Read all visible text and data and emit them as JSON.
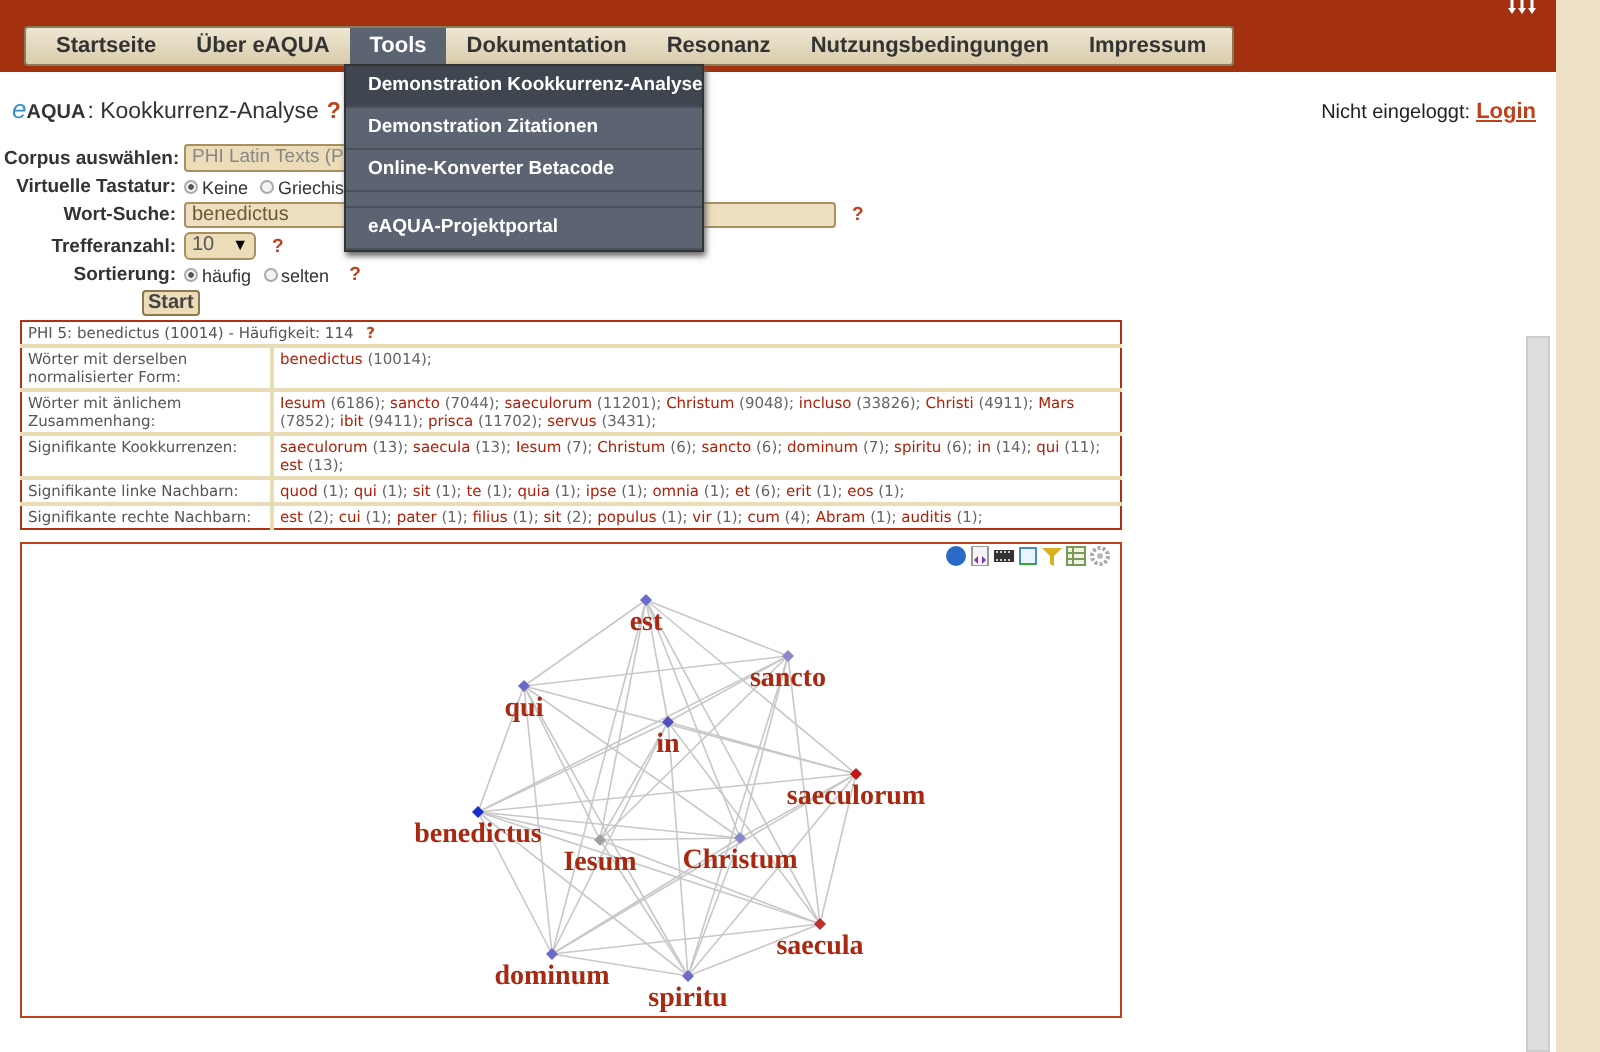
{
  "menu": [
    {
      "label": "Startseite",
      "selected": false
    },
    {
      "label": "Über eAQUA",
      "selected": false
    },
    {
      "label": "Tools",
      "selected": true
    },
    {
      "label": "Dokumentation",
      "selected": false
    },
    {
      "label": "Resonanz",
      "selected": false
    },
    {
      "label": "Nutzungsbedingungen",
      "selected": false
    },
    {
      "label": "Impressum",
      "selected": false
    }
  ],
  "dropdown": [
    {
      "kind": "item",
      "label": "Demonstration Kookkurrenz-Analyse",
      "highlighted": true
    },
    {
      "kind": "item",
      "label": "Demonstration Zitationen",
      "highlighted": false
    },
    {
      "kind": "item",
      "label": "Online-Konverter Betacode",
      "highlighted": false
    },
    {
      "kind": "separator"
    },
    {
      "kind": "item",
      "label": "eAQUA-Projektportal",
      "highlighted": false
    }
  ],
  "header": {
    "logo_prefix": "e",
    "logo": "AQUA",
    "title": ": Kookkurrenz-Analyse",
    "help": "?",
    "login_status": "Nicht eingeloggt:",
    "login_link": "Login"
  },
  "form": {
    "corpus": {
      "label": "Corpus auswählen:",
      "value": "PHI Latin Texts (P"
    },
    "keyboard": {
      "label": "Virtuelle Tastatur:",
      "options": [
        {
          "label": "Keine",
          "selected": true
        },
        {
          "label": "Griechis",
          "selected": false
        }
      ]
    },
    "word": {
      "label": "Wort-Suche:",
      "value": "benedictus",
      "help": "?"
    },
    "hits": {
      "label": "Trefferanzahl:",
      "value": "10",
      "arrow": "▼",
      "help": "?"
    },
    "sort": {
      "label": "Sortierung:",
      "options": [
        {
          "label": "häufig",
          "selected": true
        },
        {
          "label": "selten",
          "selected": false
        }
      ],
      "help": "?"
    },
    "start": "Start"
  },
  "results": {
    "title": "PHI 5: benedictus (10014) - Häufigkeit: 114",
    "help": "?",
    "rows": [
      {
        "label": "Wörter mit derselben normalisierter Form:",
        "entries": [
          {
            "word": "benedictus",
            "count": "(10014);"
          }
        ]
      },
      {
        "label": "Wörter mit änlichem Zusammenhang:",
        "entries": [
          {
            "word": "Iesum",
            "count": "(6186);"
          },
          {
            "word": "sancto",
            "count": "(7044);"
          },
          {
            "word": "saeculorum",
            "count": "(11201);"
          },
          {
            "word": "Christum",
            "count": "(9048);"
          },
          {
            "word": "incluso",
            "count": "(33826);"
          },
          {
            "word": "Christi",
            "count": "(4911);"
          },
          {
            "word": "Mars",
            "count": "(7852);"
          },
          {
            "word": "ibit",
            "count": "(9411);"
          },
          {
            "word": "prisca",
            "count": "(11702);"
          },
          {
            "word": "servus",
            "count": "(3431);"
          }
        ]
      },
      {
        "label": "Signifikante Kookkurrenzen:",
        "entries": [
          {
            "word": "saeculorum",
            "count": "(13);"
          },
          {
            "word": "saecula",
            "count": "(13);"
          },
          {
            "word": "Iesum",
            "count": "(7);"
          },
          {
            "word": "Christum",
            "count": "(6);"
          },
          {
            "word": "sancto",
            "count": "(6);"
          },
          {
            "word": "dominum",
            "count": "(7);"
          },
          {
            "word": "spiritu",
            "count": "(6);"
          },
          {
            "word": "in",
            "count": "(14);"
          },
          {
            "word": "qui",
            "count": "(11);"
          },
          {
            "word": "est",
            "count": "(13);"
          }
        ]
      },
      {
        "label": "Signifikante linke Nachbarn:",
        "entries": [
          {
            "word": "quod",
            "count": "(1);"
          },
          {
            "word": "qui",
            "count": "(1);"
          },
          {
            "word": "sit",
            "count": "(1);"
          },
          {
            "word": "te",
            "count": "(1);"
          },
          {
            "word": "quia",
            "count": "(1);"
          },
          {
            "word": "ipse",
            "count": "(1);"
          },
          {
            "word": "omnia",
            "count": "(1);"
          },
          {
            "word": "et",
            "count": "(6);"
          },
          {
            "word": "erit",
            "count": "(1);"
          },
          {
            "word": "eos",
            "count": "(1);"
          }
        ]
      },
      {
        "label": "Signifikante rechte Nachbarn:",
        "entries": [
          {
            "word": "est",
            "count": "(2);"
          },
          {
            "word": "cui",
            "count": "(1);"
          },
          {
            "word": "pater",
            "count": "(1);"
          },
          {
            "word": "filius",
            "count": "(1);"
          },
          {
            "word": "sit",
            "count": "(2);"
          },
          {
            "word": "populus",
            "count": "(1);"
          },
          {
            "word": "vir",
            "count": "(1);"
          },
          {
            "word": "cum",
            "count": "(4);"
          },
          {
            "word": "Abram",
            "count": "(1);"
          },
          {
            "word": "auditis",
            "count": "(1);"
          }
        ]
      }
    ]
  },
  "graph": {
    "nodes": [
      {
        "word": "est",
        "color": "#6a6ac8"
      },
      {
        "word": "sancto",
        "color": "#8a8ac8"
      },
      {
        "word": "qui",
        "color": "#6a6ac8"
      },
      {
        "word": "in",
        "color": "#5050c0"
      },
      {
        "word": "saeculorum",
        "color": "#c01818"
      },
      {
        "word": "benedictus",
        "color": "#1830c8"
      },
      {
        "word": "Iesum",
        "color": "#a0a0a0"
      },
      {
        "word": "Christum",
        "color": "#8a8ac8"
      },
      {
        "word": "saecula",
        "color": "#c03030"
      },
      {
        "word": "dominum",
        "color": "#6a6ac8"
      },
      {
        "word": "spiritu",
        "color": "#6a6ac8"
      }
    ]
  }
}
